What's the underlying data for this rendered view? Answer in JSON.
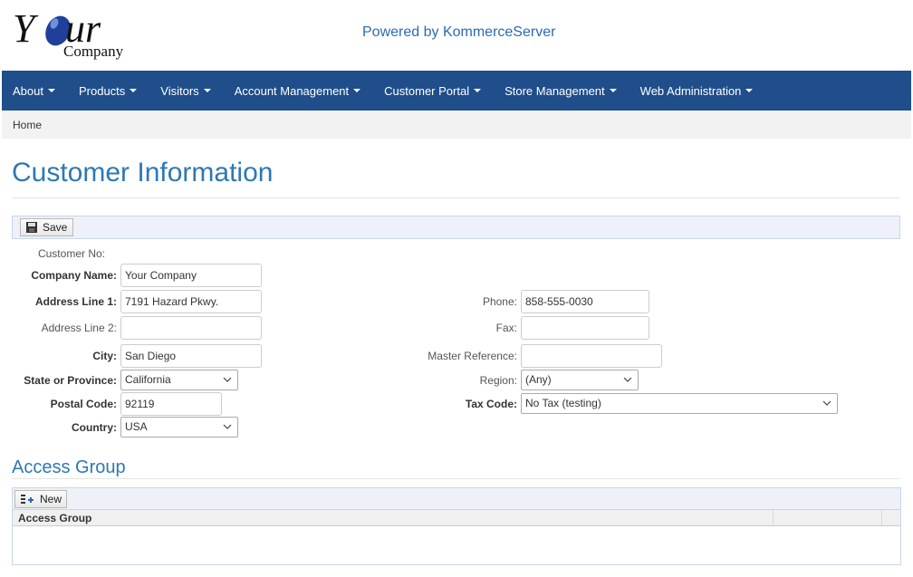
{
  "header": {
    "logo": {
      "word": "Your",
      "sub": "Company"
    },
    "powered_by": "Powered by KommerceServer"
  },
  "nav": {
    "items": [
      "About",
      "Products",
      "Visitors",
      "Account Management",
      "Customer Portal",
      "Store Management",
      "Web Administration"
    ]
  },
  "breadcrumb": {
    "home": "Home"
  },
  "page": {
    "title": "Customer Information"
  },
  "toolbar": {
    "save_label": "Save"
  },
  "form": {
    "customer_no_label": "Customer No:",
    "company_name_label": "Company Name:",
    "company_name_value": "Your Company",
    "address1_label": "Address Line 1:",
    "address1_value": "7191 Hazard Pkwy.",
    "address2_label": "Address Line 2:",
    "address2_value": "",
    "city_label": "City:",
    "city_value": "San Diego",
    "state_label": "State or Province:",
    "state_value": "California",
    "postal_label": "Postal Code:",
    "postal_value": "92119",
    "country_label": "Country:",
    "country_value": "USA",
    "phone_label": "Phone:",
    "phone_value": "858-555-0030",
    "fax_label": "Fax:",
    "fax_value": "",
    "master_ref_label": "Master Reference:",
    "master_ref_value": "",
    "region_label": "Region:",
    "region_value": "(Any)",
    "tax_code_label": "Tax Code:",
    "tax_code_value": "No Tax (testing)"
  },
  "access_group": {
    "title": "Access Group",
    "new_label": "New",
    "column_header": "Access Group"
  },
  "colors": {
    "nav_bg": "#1f4e8a",
    "title": "#2e78b4",
    "powered": "#2a6ab3"
  }
}
